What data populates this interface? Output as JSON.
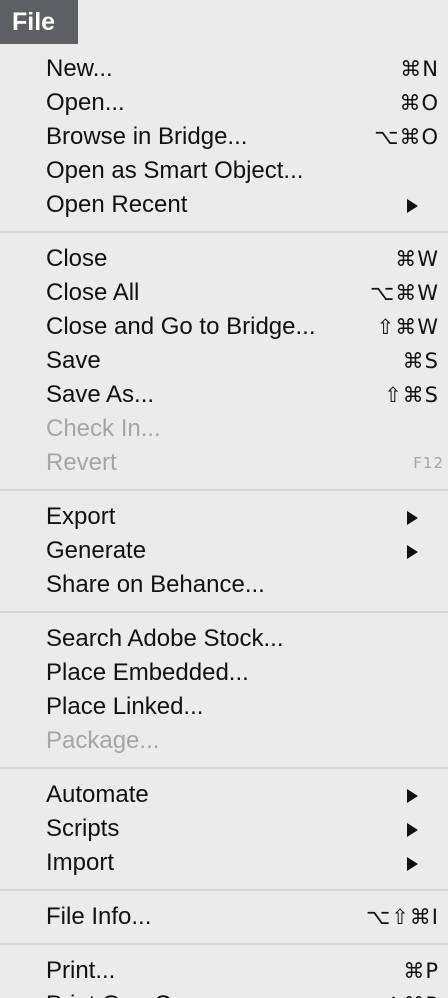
{
  "menubar": {
    "title": "File"
  },
  "menu": {
    "groups": [
      [
        {
          "label": "New...",
          "shortcut": "⌘N"
        },
        {
          "label": "Open...",
          "shortcut": "⌘O"
        },
        {
          "label": "Browse in Bridge...",
          "shortcut": "⌥⌘O"
        },
        {
          "label": "Open as Smart Object...",
          "shortcut": ""
        },
        {
          "label": "Open Recent",
          "submenu": true
        }
      ],
      [
        {
          "label": "Close",
          "shortcut": "⌘W"
        },
        {
          "label": "Close All",
          "shortcut": "⌥⌘W"
        },
        {
          "label": "Close and Go to Bridge...",
          "shortcut": "⇧⌘W"
        },
        {
          "label": "Save",
          "shortcut": "⌘S"
        },
        {
          "label": "Save As...",
          "shortcut": "⇧⌘S"
        },
        {
          "label": "Check In...",
          "shortcut": "",
          "disabled": true
        },
        {
          "label": "Revert",
          "shortcut": "F12",
          "disabled": true
        }
      ],
      [
        {
          "label": "Export",
          "submenu": true
        },
        {
          "label": "Generate",
          "submenu": true
        },
        {
          "label": "Share on Behance...",
          "shortcut": ""
        }
      ],
      [
        {
          "label": "Search Adobe Stock...",
          "shortcut": ""
        },
        {
          "label": "Place Embedded...",
          "shortcut": ""
        },
        {
          "label": "Place Linked...",
          "shortcut": ""
        },
        {
          "label": "Package...",
          "shortcut": "",
          "disabled": true
        }
      ],
      [
        {
          "label": "Automate",
          "submenu": true
        },
        {
          "label": "Scripts",
          "submenu": true
        },
        {
          "label": "Import",
          "submenu": true
        }
      ],
      [
        {
          "label": "File Info...",
          "shortcut": "⌥⇧⌘I"
        }
      ],
      [
        {
          "label": "Print...",
          "shortcut": "⌘P"
        },
        {
          "label": "Print One Copy",
          "shortcut": "⌥⇧⌘P"
        }
      ]
    ]
  },
  "colors": {
    "menu_background": "#ebebeb",
    "title_background": "#5d5f63",
    "text": "#111111",
    "disabled_text": "#a5a5a5",
    "separator": "#d6d6d6"
  }
}
